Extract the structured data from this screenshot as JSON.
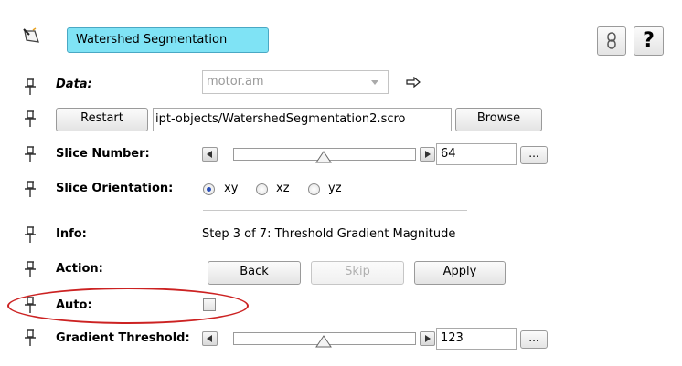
{
  "module": {
    "title": "Watershed Segmentation",
    "icon": "wand-icon"
  },
  "top_buttons": {
    "dependency_icon": "link-icon",
    "help_label": "?"
  },
  "rows": {
    "data": {
      "label": "Data:",
      "value": "motor.am",
      "arrow_icon": "arrow-right-icon"
    },
    "script": {
      "restart_label": "Restart",
      "path": "ipt-objects/WatershedSegmentation2.scro",
      "browse_label": "Browse"
    },
    "slice_number": {
      "label": "Slice Number:",
      "value": "64",
      "slider_fraction": 0.5,
      "more_label": "..."
    },
    "slice_orientation": {
      "label": "Slice Orientation:",
      "options": [
        "xy",
        "xz",
        "yz"
      ],
      "selected": "xy"
    },
    "info": {
      "label": "Info:",
      "text": "Step 3 of 7: Threshold Gradient Magnitude"
    },
    "action": {
      "label": "Action:",
      "back_label": "Back",
      "skip_label": "Skip",
      "apply_label": "Apply"
    },
    "auto": {
      "label": "Auto:",
      "checked": false
    },
    "gradient_threshold": {
      "label": "Gradient Threshold:",
      "value": "123",
      "slider_fraction": 0.5,
      "more_label": "..."
    }
  },
  "colors": {
    "title_bg": "#7fe3f5",
    "highlight_ellipse": "#cc2222"
  }
}
